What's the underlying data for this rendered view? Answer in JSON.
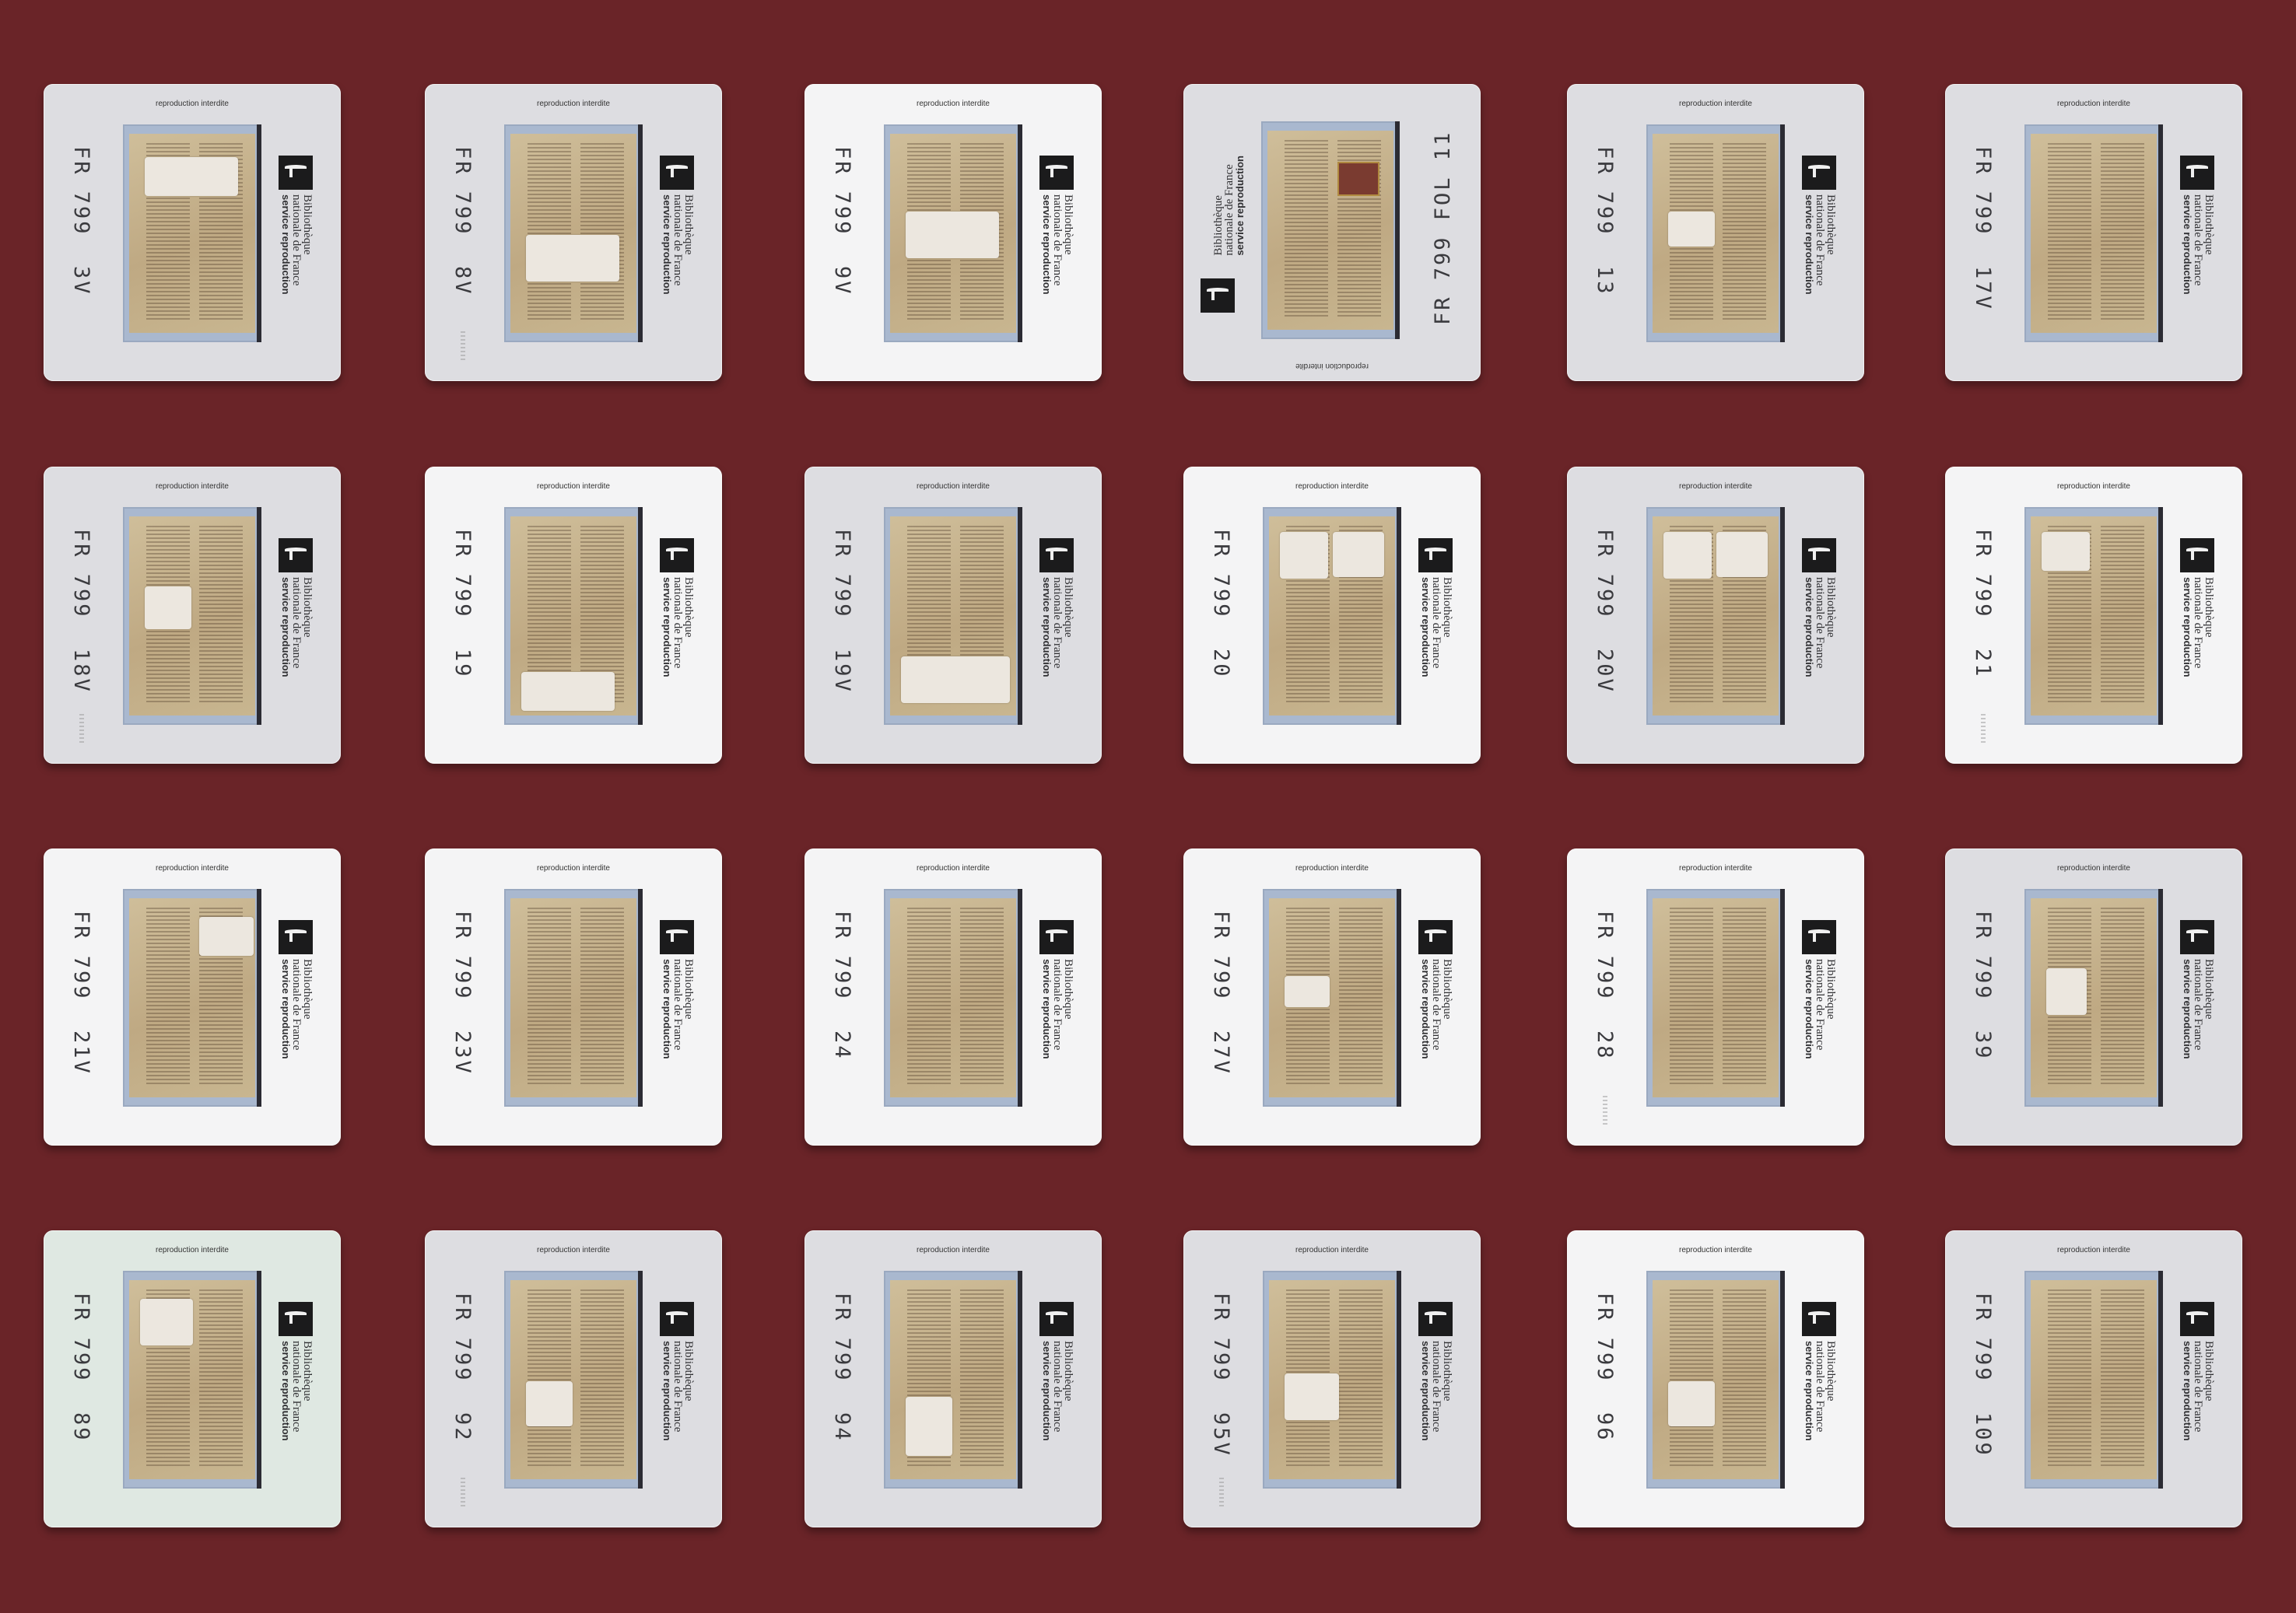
{
  "background_color": "#6a2428",
  "agency": {
    "line1": "Bibliothèque",
    "line2": "nationale de France",
    "line3": "service reproduction"
  },
  "notice": "reproduction interdite",
  "slides": [
    {
      "label": "FR 799  3V",
      "tone": "grey",
      "flip": false
    },
    {
      "label": "FR 799  8V",
      "tone": "grey",
      "flip": false
    },
    {
      "label": "FR 799  9V",
      "tone": "white",
      "flip": false
    },
    {
      "label": "FR 799 FOL 11",
      "tone": "grey",
      "flip": true
    },
    {
      "label": "FR 799  13",
      "tone": "grey",
      "flip": false
    },
    {
      "label": "FR 799  17V",
      "tone": "grey",
      "flip": false
    },
    {
      "label": "FR 799  18V",
      "tone": "grey",
      "flip": false
    },
    {
      "label": "FR 799  19",
      "tone": "white",
      "flip": false
    },
    {
      "label": "FR 799  19V",
      "tone": "grey",
      "flip": false
    },
    {
      "label": "FR 799  20",
      "tone": "white",
      "flip": false
    },
    {
      "label": "FR 799  20V",
      "tone": "grey",
      "flip": false
    },
    {
      "label": "FR 799  21",
      "tone": "white",
      "flip": false
    },
    {
      "label": "FR 799  21V",
      "tone": "white",
      "flip": false
    },
    {
      "label": "FR 799  23V",
      "tone": "white",
      "flip": false
    },
    {
      "label": "FR 799  24",
      "tone": "white",
      "flip": false
    },
    {
      "label": "FR 799  27V",
      "tone": "white",
      "flip": false
    },
    {
      "label": "FR 799  28",
      "tone": "white",
      "flip": false
    },
    {
      "label": "FR 799  39",
      "tone": "grey",
      "flip": false
    },
    {
      "label": "FR 799  89",
      "tone": "green",
      "flip": false
    },
    {
      "label": "FR 799  92",
      "tone": "grey",
      "flip": false
    },
    {
      "label": "FR 799  94",
      "tone": "grey",
      "flip": false
    },
    {
      "label": "FR 799  95V",
      "tone": "grey",
      "flip": false
    },
    {
      "label": "FR 799  96",
      "tone": "white",
      "flip": false
    },
    {
      "label": "FR 799  109",
      "tone": "grey",
      "flip": false
    }
  ]
}
